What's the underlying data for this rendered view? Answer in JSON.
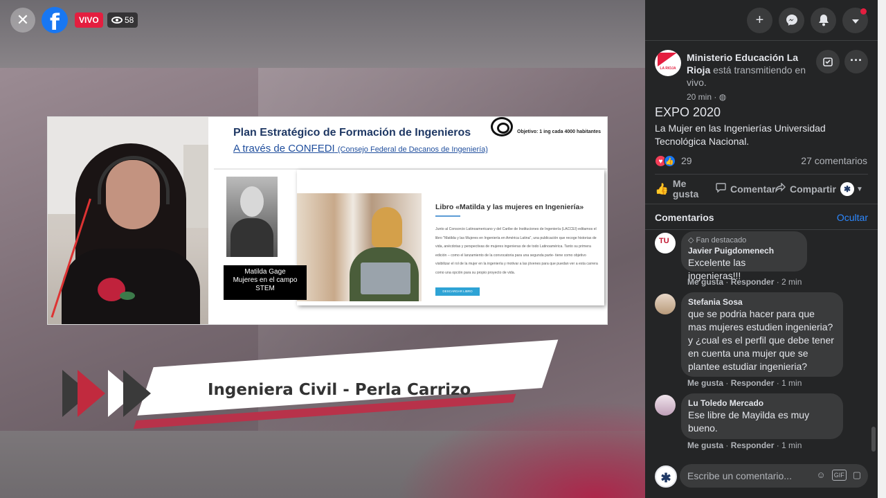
{
  "video": {
    "live_label": "VIVO",
    "viewer_count": "58",
    "slide": {
      "title": "Plan Estratégico de Formación de Ingenieros",
      "subtitle_main": "A través de CONFEDI",
      "subtitle_small": "(Consejo Federal de Decanos de Ingeniería)",
      "objective": "Objetivo: 1 ing cada 4000 habitantes",
      "portrait_caption_line1": "Matilda Gage",
      "portrait_caption_line2": "Mujeres en el campo",
      "portrait_caption_line3": "STEM",
      "book_title": "Libro «Matilda y las mujeres en Ingeniería»",
      "book_text": "Junto al Consorcio Latinoamericano y del Caribe de Instituciones de Ingeniería (LACCEI) editamos el libro \"Matilda y las Mujeres en Ingeniería en América Latina\", una publicación que recoge historias de vida, anécdotas y perspectivas de mujeres ingenieras de de todo Latinoamérica. Tanto su primera edición – como el lanzamiento de la convocatoria para una segunda parte- tiene como objetivo visibilizar el rol de la mujer en la ingeniería y motivar a las jóvenes para que puedan ver a esta carrera como una opción para su propio proyecto de vida.",
      "book_button": "DESCARGAR LIBRO"
    },
    "lower_third_name": "Ingeniera Civil - Perla Carrizo"
  },
  "post": {
    "page_name": "Ministerio Educación La Rioja",
    "action_text": "está transmitiendo en vivo.",
    "avatar_text": "LA RIOJA",
    "time": "20 min",
    "title": "EXPO 2020",
    "description": "La Mujer en las Ingenierías Universidad Tecnológica Nacional.",
    "reaction_count": "29",
    "comment_count": "27 comentarios",
    "actions": {
      "like": "Me gusta",
      "comment": "Comentar",
      "share": "Compartir"
    }
  },
  "comments_section": {
    "label": "Comentarios",
    "hide": "Ocultar",
    "items": [
      {
        "badge": "Fan destacado",
        "author": "Javier Puigdomenech",
        "text": "Excelente las ingenieras!!!",
        "like": "Me gusta",
        "reply": "Responder",
        "time": "2 min"
      },
      {
        "author": "Stefania Sosa",
        "text": "que se podria hacer para que mas mujeres estudien ingenieria? y ¿cual es el perfil que debe tener en cuenta una mujer que se plantee estudiar ingenieria?",
        "like": "Me gusta",
        "reply": "Responder",
        "time": "1 min"
      },
      {
        "author": "Lu Toledo Mercado",
        "text": "Ese libre de Mayilda es muy bueno.",
        "like": "Me gusta",
        "reply": "Responder",
        "time": "1 min"
      }
    ],
    "composer_placeholder": "Escribe un comentario..."
  },
  "icons": {
    "close": "close-icon",
    "facebook": "facebook-logo",
    "eye": "eye-icon",
    "plus": "plus-icon",
    "messenger": "messenger-icon",
    "bell": "bell-icon",
    "dropdown": "caret-down-icon",
    "save": "save-icon",
    "more": "ellipsis-icon",
    "globe": "globe-icon"
  },
  "colors": {
    "live_red": "#e41e3f",
    "fb_blue": "#1877f2",
    "panel_bg": "#242526",
    "bubble_bg": "#3a3b3c",
    "link_blue": "#2d88ff"
  }
}
